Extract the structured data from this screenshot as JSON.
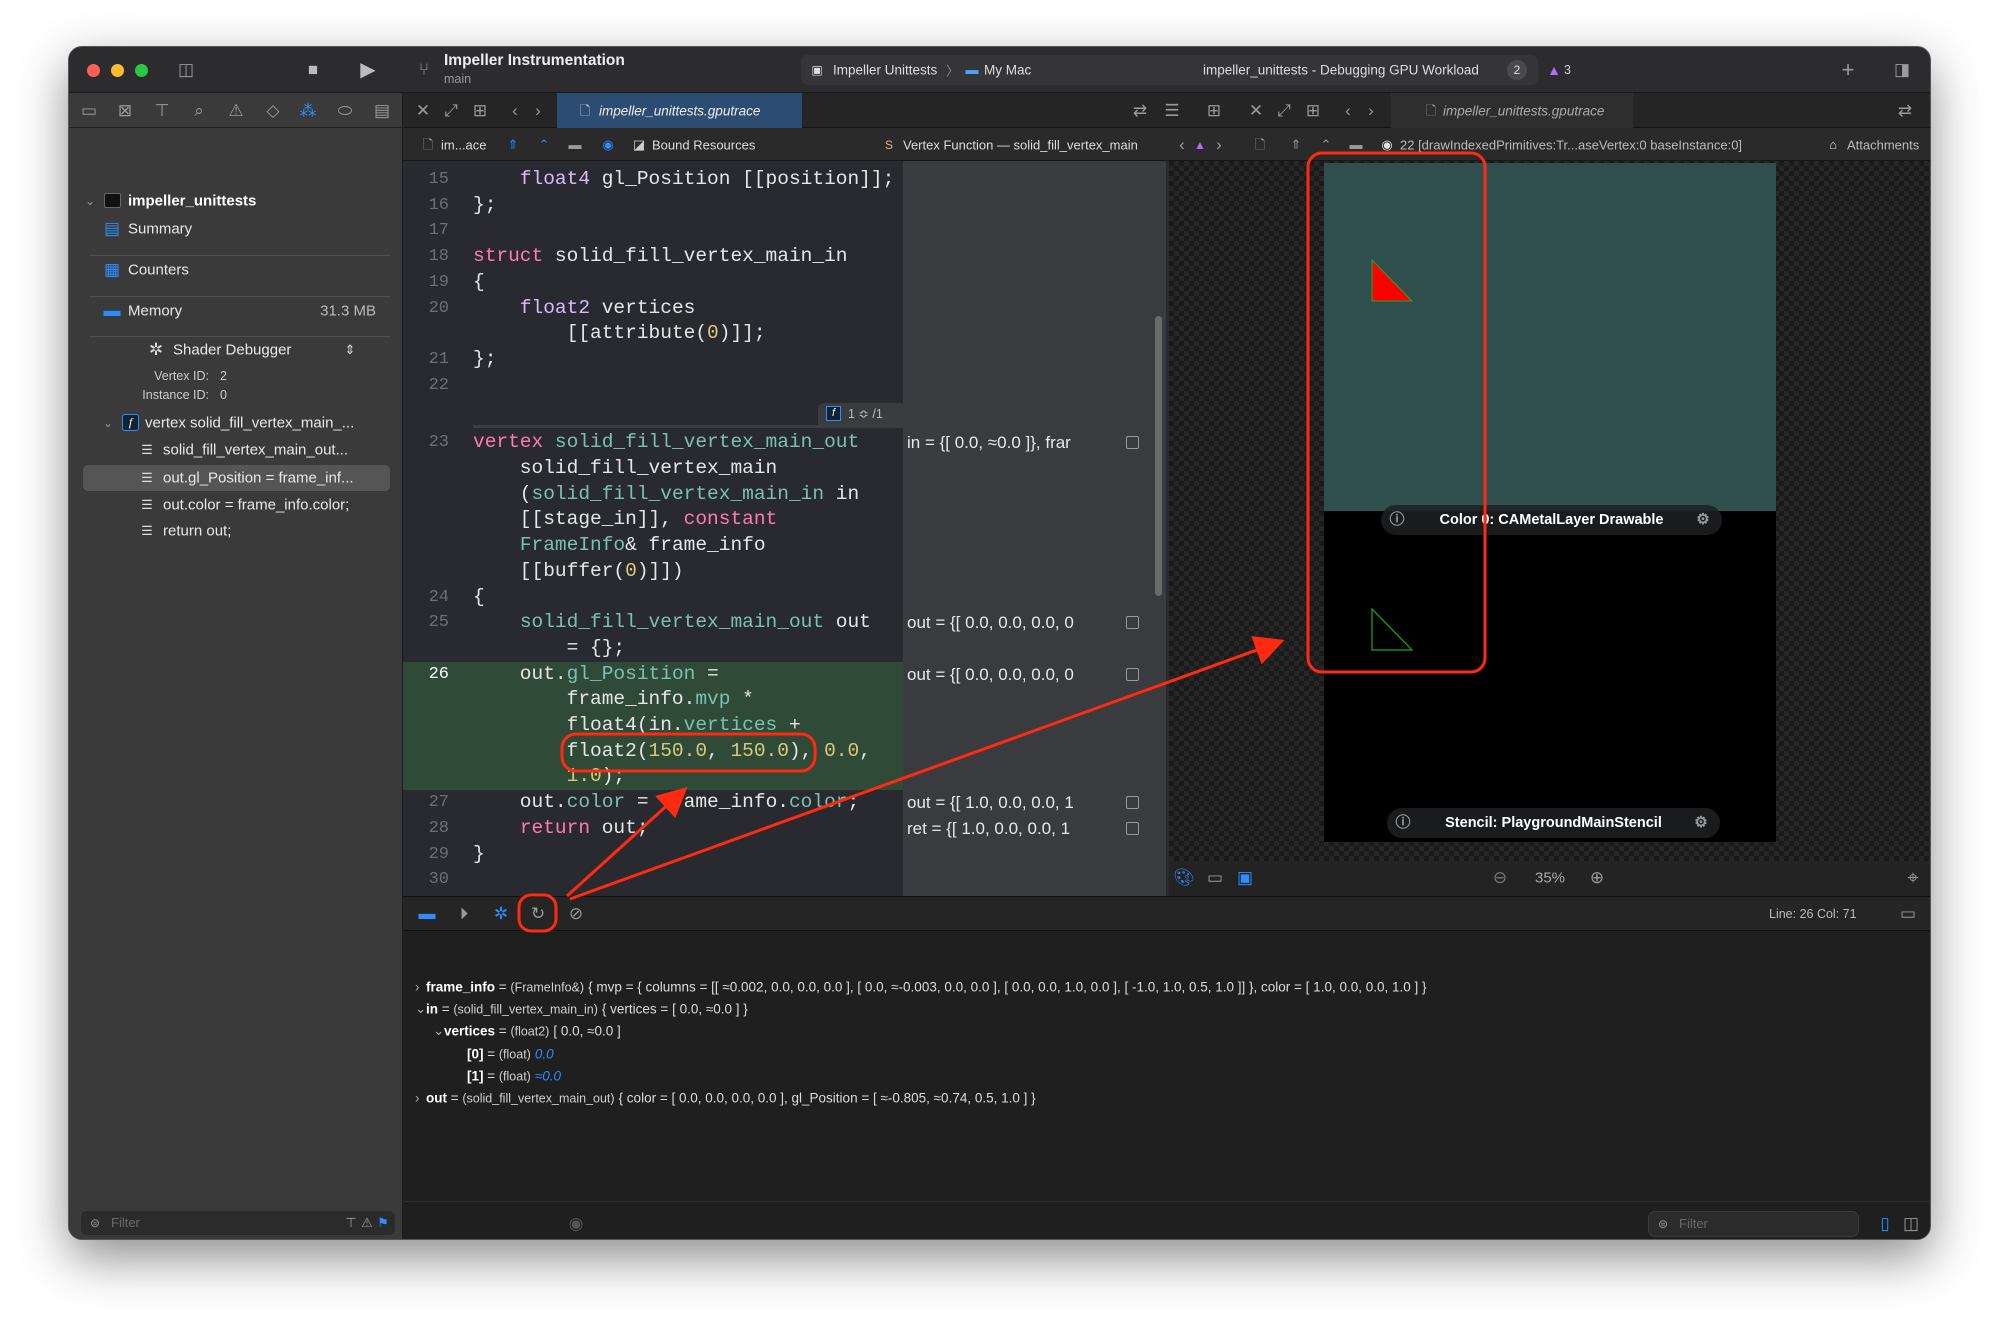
{
  "window": {
    "project_title": "Impeller Instrumentation",
    "branch": "main",
    "scheme": "Impeller Unittests",
    "destination": "My Mac",
    "status": "impeller_unittests - Debugging GPU Workload",
    "status_badge": "2",
    "warning_count": "3"
  },
  "sidebar": {
    "root": "impeller_unittests",
    "items": [
      {
        "label": "Summary",
        "value": ""
      },
      {
        "label": "Counters",
        "value": ""
      },
      {
        "label": "Memory",
        "value": "31.3 MB"
      }
    ],
    "debugger_mode": "Shader Debugger",
    "vertex_id_label": "Vertex ID:",
    "vertex_id": "2",
    "instance_id_label": "Instance ID:",
    "instance_id": "0",
    "function_node": "vertex solid_fill_vertex_main_...",
    "steps": [
      "solid_fill_vertex_main_out...",
      "out.gl_Position = frame_inf...",
      "out.color = frame_info.color;",
      "return out;"
    ],
    "selected_step": 1,
    "filter_placeholder": "Filter"
  },
  "editor_left": {
    "tab": "impeller_unittests.gputrace",
    "breadcrumbs": [
      "im...ace",
      "Bound Resources",
      "Vertex Function — solid_fill_vertex_main"
    ],
    "function_badge": "1 ≎  /1"
  },
  "editor_right": {
    "tab": "impeller_unittests.gputrace",
    "breadcrumbs": [
      "22 [drawIndexedPrimitives:Tr...aseVertex:0 baseInstance:0]",
      "Attachments"
    ],
    "attachments": [
      {
        "label": "Color 0: CAMetalLayer Drawable",
        "background": "#2f4f4f",
        "triangle": "filled-red"
      },
      {
        "label": "Stencil: PlaygroundMainStencil",
        "background": "#000000",
        "triangle": "green-outline"
      }
    ],
    "zoom": "35%"
  },
  "code": {
    "rows": [
      {
        "n": "15",
        "segs": [
          [
            "    ",
            ""
          ],
          [
            "float4",
            "ty"
          ],
          [
            " gl_Position [[position]];",
            ""
          ]
        ]
      },
      {
        "n": "16",
        "segs": [
          [
            "};",
            ""
          ]
        ]
      },
      {
        "n": "17",
        "segs": []
      },
      {
        "n": "18",
        "segs": [
          [
            "struct",
            "kw"
          ],
          [
            " solid_fill_vertex_main_in",
            ""
          ]
        ]
      },
      {
        "n": "19",
        "segs": [
          [
            "{",
            ""
          ]
        ]
      },
      {
        "n": "20",
        "segs": [
          [
            "    ",
            ""
          ],
          [
            "float2",
            "ty"
          ],
          [
            " vertices",
            ""
          ]
        ]
      },
      {
        "n": "",
        "segs": [
          [
            "        [[attribute(",
            ""
          ],
          [
            "0",
            "num"
          ],
          [
            ")]];",
            ""
          ]
        ]
      },
      {
        "n": "21",
        "segs": [
          [
            "};",
            ""
          ]
        ]
      },
      {
        "n": "22",
        "segs": []
      },
      {
        "sep": true
      },
      {
        "n": "23",
        "segs": [
          [
            "vertex",
            "kw"
          ],
          [
            " ",
            ""
          ],
          [
            "solid_fill_vertex_main_out",
            "tt"
          ]
        ],
        "ann": "in = {[ 0.0, ≈0.0 ]}, frar"
      },
      {
        "n": "",
        "segs": [
          [
            "    solid_fill_vertex_main",
            ""
          ]
        ]
      },
      {
        "n": "",
        "segs": [
          [
            "    (",
            ""
          ],
          [
            "solid_fill_vertex_main_in",
            "tt"
          ],
          [
            " in",
            ""
          ]
        ]
      },
      {
        "n": "",
        "segs": [
          [
            "    [[stage_in]], ",
            ""
          ],
          [
            "constant",
            "kw"
          ]
        ]
      },
      {
        "n": "",
        "segs": [
          [
            "    ",
            ""
          ],
          [
            "FrameInfo",
            "tt"
          ],
          [
            "& frame_info",
            ""
          ]
        ]
      },
      {
        "n": "",
        "segs": [
          [
            "    [[buffer(",
            ""
          ],
          [
            "0",
            "num"
          ],
          [
            ")]])",
            ""
          ]
        ]
      },
      {
        "n": "24",
        "segs": [
          [
            "{",
            ""
          ]
        ]
      },
      {
        "n": "25",
        "segs": [
          [
            "    ",
            ""
          ],
          [
            "solid_fill_vertex_main_out",
            "tt"
          ],
          [
            " out",
            ""
          ]
        ],
        "ann": "out = {[ 0.0, 0.0, 0.0, 0"
      },
      {
        "n": "",
        "segs": [
          [
            "        = {};",
            ""
          ]
        ]
      },
      {
        "n": "26",
        "hl": true,
        "segs": [
          [
            "    out.",
            ""
          ],
          [
            "gl_Position",
            "tt"
          ],
          [
            " =",
            ""
          ]
        ],
        "ann": "out = {[ 0.0, 0.0, 0.0, 0",
        "ann_plain": true
      },
      {
        "n": "",
        "hl": true,
        "segs": [
          [
            "        frame_info.",
            ""
          ],
          [
            "mvp",
            "tt"
          ],
          [
            " *",
            ""
          ]
        ]
      },
      {
        "n": "",
        "hl": true,
        "segs": [
          [
            "        float4(in.",
            ""
          ],
          [
            "vertices",
            "tt"
          ],
          [
            " +",
            ""
          ]
        ]
      },
      {
        "n": "",
        "hl": true,
        "segs": [
          [
            "        float2(",
            ""
          ],
          [
            "150.0",
            "num"
          ],
          [
            ", ",
            ""
          ],
          [
            "150.0",
            "num"
          ],
          [
            "), ",
            ""
          ],
          [
            "0.0",
            "num"
          ],
          [
            ",",
            ""
          ]
        ]
      },
      {
        "n": "",
        "hl": true,
        "segs": [
          [
            "        ",
            ""
          ],
          [
            "1.0",
            "num"
          ],
          [
            ");",
            ""
          ]
        ]
      },
      {
        "n": "27",
        "segs": [
          [
            "    out.",
            ""
          ],
          [
            "color",
            "tt"
          ],
          [
            " = frame_info.",
            ""
          ],
          [
            "color",
            "tt"
          ],
          [
            ";",
            ""
          ]
        ],
        "ann": "out = {[ 1.0, 0.0, 0.0, 1"
      },
      {
        "n": "28",
        "segs": [
          [
            "    ",
            ""
          ],
          [
            "return",
            "kw"
          ],
          [
            " out;",
            ""
          ]
        ],
        "ann": "ret = {[ 1.0, 0.0, 0.0, 1"
      },
      {
        "n": "29",
        "segs": [
          [
            "}",
            ""
          ]
        ]
      },
      {
        "n": "30",
        "segs": []
      }
    ]
  },
  "debug_bar": {
    "cursor": "Line: 26  Col: 71"
  },
  "console": [
    {
      "indent": 0,
      "chev": "›",
      "name": "frame_info",
      "type": "(FrameInfo&)",
      "value": "{ mvp = { columns = [[ ≈0.002, 0.0, 0.0, 0.0 ], [ 0.0, ≈-0.003, 0.0, 0.0 ], [ 0.0, 0.0, 1.0, 0.0 ], [ -1.0, 1.0, 0.5, 1.0 ]] }, color = [ 1.0, 0.0, 0.0, 1.0 ] }"
    },
    {
      "indent": 0,
      "chev": "⌄",
      "name": "in",
      "type": "(solid_fill_vertex_main_in)",
      "value": "{ vertices = [ 0.0, ≈0.0 ] }"
    },
    {
      "indent": 1,
      "chev": "⌄",
      "name": "vertices",
      "type": "(float2)",
      "value": "[ 0.0, ≈0.0 ]"
    },
    {
      "indent": 2,
      "chev": "",
      "name": "[0]",
      "type": "(float)",
      "value": "0.0",
      "italic": true
    },
    {
      "indent": 2,
      "chev": "",
      "name": "[1]",
      "type": "(float)",
      "value": "≈0.0",
      "italic": true
    },
    {
      "indent": 0,
      "chev": "›",
      "name": "out",
      "type": "(solid_fill_vertex_main_out)",
      "value": "{ color = [ 0.0, 0.0, 0.0, 0.0 ], gl_Position = [ ≈-0.805, ≈0.74, 0.5, 1.0 ] }"
    }
  ],
  "console_filter_placeholder": "Filter",
  "colors": {
    "accent": "#2f8cff",
    "highlight_line": "#2f4a36",
    "annotation_red": "#ff2a12",
    "triangle": "#ff0000",
    "stencil_outline": "#1fa81f"
  }
}
